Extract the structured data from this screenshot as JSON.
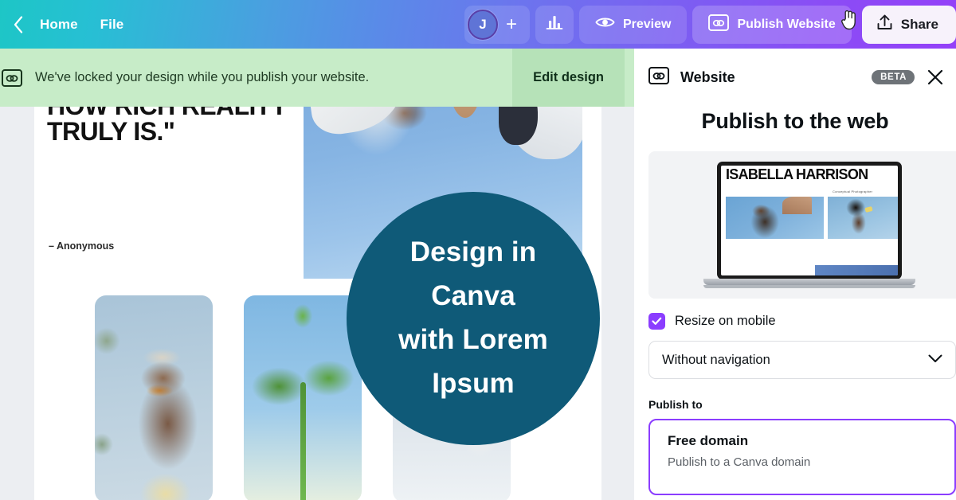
{
  "topbar": {
    "back_icon": "chevron-left-icon",
    "home_label": "Home",
    "file_label": "File",
    "avatar_initial": "J",
    "add_member_label": "+",
    "insights_icon": "bar-chart-icon",
    "preview_label": "Preview",
    "preview_icon": "eye-icon",
    "publish_label": "Publish Website",
    "publish_icon": "website-icon",
    "share_label": "Share",
    "share_icon": "upload-icon",
    "cursor": "pointer-hand-cursor"
  },
  "notice": {
    "icon": "website-icon",
    "message": "We've locked your design while you publish your website.",
    "action_label": "Edit design"
  },
  "canvas": {
    "quote_text": "IMAGE, FREEZING A MOMENT, REVEALS HOW RICH REALITY TRULY IS.\"",
    "quote_attribution": "– Anonymous",
    "overlay_text": "Design in\nCanva\nwith Lorem\nIpsum",
    "overlay_color": "#0f5a78",
    "photos": [
      {
        "name": "sky-people-photo"
      },
      {
        "name": "woman-sunglasses-photo"
      },
      {
        "name": "green-leaf-photo"
      },
      {
        "name": "woman-camera-photo"
      }
    ]
  },
  "panel": {
    "header_icon": "website-icon",
    "header_title": "Website",
    "badge": "BETA",
    "close_icon": "close-icon",
    "title": "Publish to the web",
    "preview": {
      "device": "laptop-mockup",
      "site_name": "ISABELLA HARRISON",
      "site_tagline": "Conceptual Photographer"
    },
    "resize_checkbox": {
      "label": "Resize on mobile",
      "checked": true,
      "accent": "#8b3dff"
    },
    "navigation_select": {
      "value": "Without navigation",
      "caret_icon": "chevron-down-icon"
    },
    "publish_to_label": "Publish to",
    "domain_option": {
      "title": "Free domain",
      "subtitle": "Publish to a Canva domain",
      "selected": true,
      "accent": "#8b3dff"
    }
  }
}
